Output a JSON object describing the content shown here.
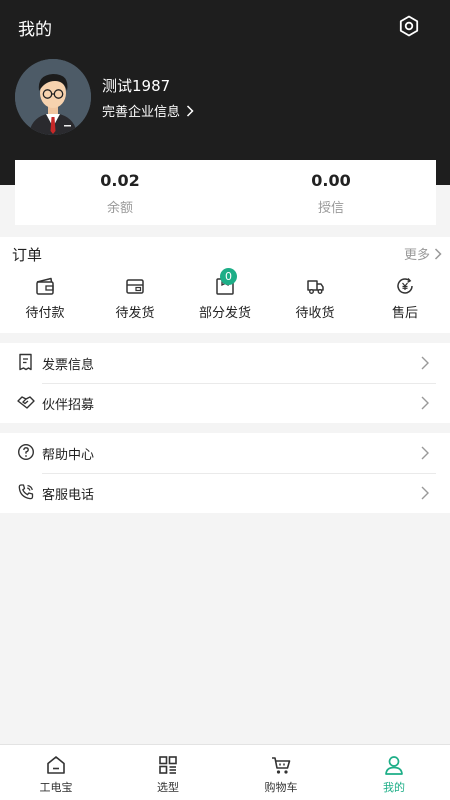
{
  "header": {
    "title": "我的"
  },
  "profile": {
    "username": "测试1987",
    "company_link": "完善企业信息"
  },
  "balance": [
    {
      "value": "0.02",
      "label": "余额"
    },
    {
      "value": "0.00",
      "label": "授信"
    }
  ],
  "orders": {
    "title": "订单",
    "more": "更多",
    "items": [
      {
        "label": "待付款",
        "icon": "wallet-icon"
      },
      {
        "label": "待发货",
        "icon": "pending-ship-icon"
      },
      {
        "label": "部分发货",
        "icon": "package-icon",
        "badge": "0"
      },
      {
        "label": "待收货",
        "icon": "truck-icon"
      },
      {
        "label": "售后",
        "icon": "after-sale-icon"
      }
    ]
  },
  "menu_group_1": [
    {
      "label": "发票信息",
      "icon": "invoice-icon"
    },
    {
      "label": "伙伴招募",
      "icon": "handshake-icon"
    }
  ],
  "menu_group_2": [
    {
      "label": "帮助中心",
      "icon": "help-icon"
    },
    {
      "label": "客服电话",
      "icon": "phone-icon"
    }
  ],
  "tabbar": [
    {
      "label": "工电宝",
      "icon": "home-icon"
    },
    {
      "label": "选型",
      "icon": "grid-icon"
    },
    {
      "label": "购物车",
      "icon": "cart-icon"
    },
    {
      "label": "我的",
      "icon": "user-icon",
      "active": true
    }
  ],
  "colors": {
    "header_bg": "#1e1e1e",
    "accent": "#1dae87",
    "page_bg": "#f4f4f4"
  }
}
